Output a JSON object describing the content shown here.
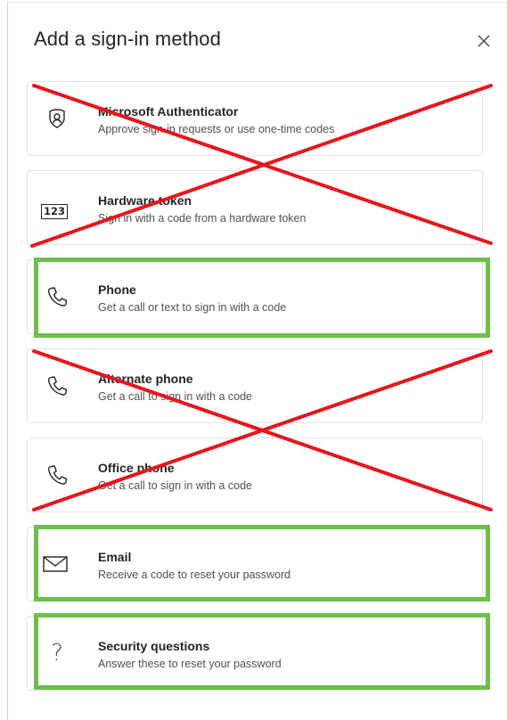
{
  "dialog": {
    "title": "Add a sign-in method",
    "close_icon": "close-icon"
  },
  "methods": [
    {
      "name": "Microsoft Authenticator",
      "description": "Approve sign-in requests or use one-time codes",
      "icon": "authenticator-lock-icon",
      "marking": "crossed-out"
    },
    {
      "name": "Hardware token",
      "description": "Sign in with a code from a hardware token",
      "icon": "hardware-token-icon",
      "icon_text": "123",
      "marking": "crossed-out"
    },
    {
      "name": "Phone",
      "description": "Get a call or text to sign in with a code",
      "icon": "phone-icon",
      "marking": "highlighted"
    },
    {
      "name": "Alternate phone",
      "description": "Get a call to sign in with a code",
      "icon": "phone-icon",
      "marking": "crossed-out"
    },
    {
      "name": "Office phone",
      "description": "Get a call to sign in with a code",
      "icon": "phone-icon",
      "marking": "crossed-out"
    },
    {
      "name": "Email",
      "description": "Receive a code to reset your password",
      "icon": "mail-icon",
      "marking": "highlighted"
    },
    {
      "name": "Security questions",
      "description": "Answer these to reset your password",
      "icon": "question-mark-icon",
      "icon_text": "?",
      "marking": "highlighted"
    }
  ],
  "annotation_colors": {
    "cross": "#e8141c",
    "highlight": "#6cc04a"
  }
}
